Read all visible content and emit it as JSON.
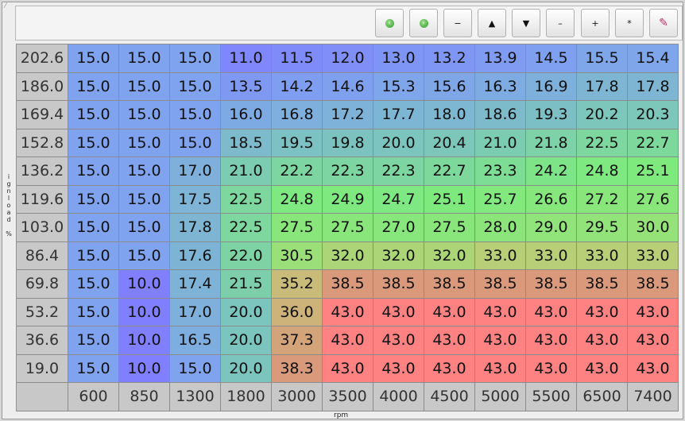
{
  "toolbar": {
    "buttons": [
      {
        "name": "circle-left-button",
        "glyph": "‹"
      },
      {
        "name": "circle-right-button",
        "glyph": "›"
      },
      {
        "name": "minus-small-button",
        "glyph": "−"
      },
      {
        "name": "arrow-up-button",
        "glyph": "▲"
      },
      {
        "name": "arrow-down-button",
        "glyph": "▼"
      },
      {
        "name": "minus-button",
        "glyph": "–"
      },
      {
        "name": "plus-button",
        "glyph": "+"
      },
      {
        "name": "multiply-button",
        "glyph": "*"
      },
      {
        "name": "pencil-button",
        "glyph": "✎"
      }
    ]
  },
  "axes": {
    "y_label": "ignload %",
    "x_label": "rpm"
  },
  "table": {
    "rows": [
      "202.6",
      "186.0",
      "169.4",
      "152.8",
      "136.2",
      "119.6",
      "103.0",
      "86.4",
      "69.8",
      "53.2",
      "36.6",
      "19.0"
    ],
    "cols": [
      "600",
      "850",
      "1300",
      "1800",
      "3000",
      "3500",
      "4000",
      "4500",
      "5000",
      "5500",
      "6500",
      "7400"
    ],
    "values": [
      [
        "15.0",
        "15.0",
        "15.0",
        "11.0",
        "11.5",
        "12.0",
        "13.0",
        "13.2",
        "13.9",
        "14.5",
        "15.5",
        "15.4"
      ],
      [
        "15.0",
        "15.0",
        "15.0",
        "13.5",
        "14.2",
        "14.6",
        "15.3",
        "15.6",
        "16.3",
        "16.9",
        "17.8",
        "17.8"
      ],
      [
        "15.0",
        "15.0",
        "15.0",
        "16.0",
        "16.8",
        "17.2",
        "17.7",
        "18.0",
        "18.6",
        "19.3",
        "20.2",
        "20.3"
      ],
      [
        "15.0",
        "15.0",
        "15.0",
        "18.5",
        "19.5",
        "19.8",
        "20.0",
        "20.4",
        "21.0",
        "21.8",
        "22.5",
        "22.7"
      ],
      [
        "15.0",
        "15.0",
        "17.0",
        "21.0",
        "22.2",
        "22.3",
        "22.3",
        "22.7",
        "23.3",
        "24.2",
        "24.8",
        "25.1"
      ],
      [
        "15.0",
        "15.0",
        "17.5",
        "22.5",
        "24.8",
        "24.9",
        "24.7",
        "25.1",
        "25.7",
        "26.6",
        "27.2",
        "27.6"
      ],
      [
        "15.0",
        "15.0",
        "17.8",
        "22.5",
        "27.5",
        "27.5",
        "27.0",
        "27.5",
        "28.0",
        "29.0",
        "29.5",
        "30.0"
      ],
      [
        "15.0",
        "15.0",
        "17.6",
        "22.0",
        "30.5",
        "32.0",
        "32.0",
        "32.0",
        "33.0",
        "33.0",
        "33.0",
        "33.0"
      ],
      [
        "15.0",
        "10.0",
        "17.4",
        "21.5",
        "35.2",
        "38.5",
        "38.5",
        "38.5",
        "38.5",
        "38.5",
        "38.5",
        "38.5"
      ],
      [
        "15.0",
        "10.0",
        "17.0",
        "20.0",
        "36.0",
        "43.0",
        "43.0",
        "43.0",
        "43.0",
        "43.0",
        "43.0",
        "43.0"
      ],
      [
        "15.0",
        "10.0",
        "16.5",
        "20.0",
        "37.3",
        "43.0",
        "43.0",
        "43.0",
        "43.0",
        "43.0",
        "43.0",
        "43.0"
      ],
      [
        "15.0",
        "10.0",
        "15.0",
        "20.0",
        "38.3",
        "43.0",
        "43.0",
        "43.0",
        "43.0",
        "43.0",
        "43.0",
        "43.0"
      ]
    ]
  },
  "colors": {
    "header_bg": "#c8c8c8",
    "low": "#7f7ffe",
    "mid_blue": "#7fa2ee",
    "green": "#7ee87d",
    "orange": "#d89a78",
    "red": "#ff8383"
  }
}
